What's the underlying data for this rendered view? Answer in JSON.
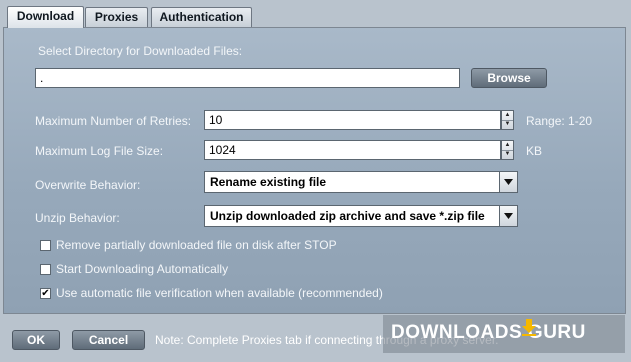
{
  "tabs": [
    {
      "label": "Download",
      "active": true
    },
    {
      "label": "Proxies",
      "active": false
    },
    {
      "label": "Authentication",
      "active": false
    }
  ],
  "directory": {
    "label": "Select Directory for Downloaded Files:",
    "value": ".",
    "browse_label": "Browse"
  },
  "retries": {
    "label": "Maximum Number of Retries:",
    "value": "10",
    "hint": "Range: 1-20"
  },
  "logsize": {
    "label": "Maximum Log File Size:",
    "value": "1024",
    "hint": "KB"
  },
  "overwrite": {
    "label": "Overwrite Behavior:",
    "value": "Rename existing file"
  },
  "unzip": {
    "label": "Unzip Behavior:",
    "value": "Unzip downloaded zip archive and save *.zip file"
  },
  "checkboxes": [
    {
      "label": "Remove partially downloaded file on disk after STOP",
      "checked": false
    },
    {
      "label": "Start Downloading Automatically",
      "checked": false
    },
    {
      "label": "Use automatic file verification when available (recommended)",
      "checked": true,
      "mark": "✔"
    }
  ],
  "footer": {
    "ok_label": "OK",
    "cancel_label": "Cancel",
    "note": "Note: Complete Proxies tab if connecting through a proxy server."
  },
  "watermark": {
    "text": "DOWNLOADS GURU"
  },
  "colors": {
    "panel": "#9fb1c3",
    "button": "#6d7a87",
    "accent_watermark": "#f5b800"
  }
}
